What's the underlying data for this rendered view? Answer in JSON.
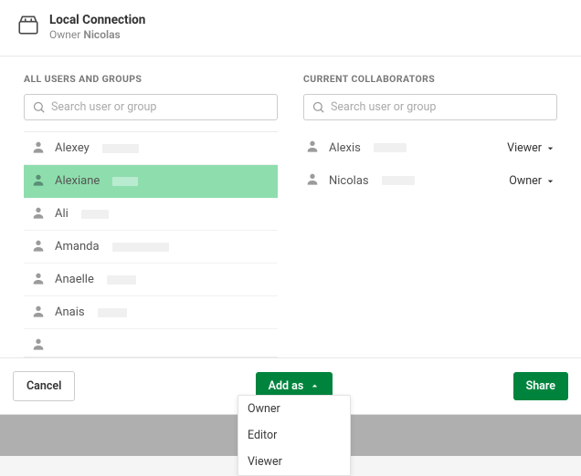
{
  "header": {
    "title": "Local Connection",
    "owner_prefix": "Owner",
    "owner_name": "Nicolas"
  },
  "left": {
    "section_label": "ALL USERS AND GROUPS",
    "search_placeholder": "Search user or group",
    "users": [
      {
        "name": "Alexey",
        "surname_w": 40,
        "selected": false
      },
      {
        "name": "Alexiane",
        "surname_w": 28,
        "selected": true
      },
      {
        "name": "Ali",
        "surname_w": 30,
        "selected": false
      },
      {
        "name": "Amanda",
        "surname_w": 62,
        "selected": false
      },
      {
        "name": "Anaelle",
        "surname_w": 32,
        "selected": false
      },
      {
        "name": "Anais",
        "surname_w": 32,
        "selected": false
      }
    ]
  },
  "right": {
    "section_label": "CURRENT COLLABORATORS",
    "search_placeholder": "Search user or group",
    "collabs": [
      {
        "name": "Alexis",
        "surname_w": 36,
        "role": "Viewer"
      },
      {
        "name": "Nicolas",
        "surname_w": 36,
        "role": "Owner"
      }
    ]
  },
  "footer": {
    "cancel": "Cancel",
    "add_as": "Add as",
    "share": "Share",
    "options": [
      "Owner",
      "Editor",
      "Viewer"
    ]
  }
}
